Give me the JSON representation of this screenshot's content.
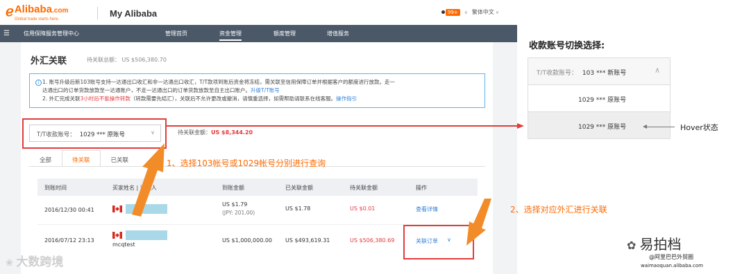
{
  "header": {
    "logo": "Alibaba",
    "logo_suffix": ".com",
    "logo_tagline": "Global trade starts here.",
    "my_alibaba": "My Alibaba",
    "badge": "99+",
    "language": "繁体中文"
  },
  "navbar": {
    "section_title": "信用保障服务管理中心",
    "tabs": [
      {
        "label": "管理首页",
        "active": false
      },
      {
        "label": "资金管理",
        "active": true
      },
      {
        "label": "额度管理",
        "active": false
      },
      {
        "label": "增值服务",
        "active": false
      }
    ]
  },
  "page": {
    "title": "外汇关联",
    "pending_total": "待关联总额： US $506,380.70",
    "notice_line1": "1. 账号升级后新103账号支持一达通出口收汇和非一达通出口收汇，T/T款项到账后资金将冻结，需关联至信用保障订单并根据客户的额度进行放款。走一",
    "notice_line2a": "达通出口的订单货款放款至一达通账户，不走一达通出口的订单货款放款至自主出口账户。",
    "notice_line2_link": "升级T/T账号",
    "notice_line3a": "2. 外汇完成关联",
    "notice_line3_red": "3小时后不能操作转款",
    "notice_line3b": "（转款需要先结汇），关联后不允许更改或撤消，请慎重选择，如需帮助请联系在线客服。",
    "notice_line3_link": "操作指引",
    "account_label": "T/T收款账号：",
    "account_value": "1029 *** 原账号",
    "pending_label": "待关联金额：",
    "pending_value": "US $8,344.20",
    "tabs": [
      {
        "label": "全部",
        "active": false
      },
      {
        "label": "待关联",
        "active": true
      },
      {
        "label": "已关联",
        "active": false
      }
    ],
    "columns": [
      "到账时间",
      "买家姓名 | 汇款人",
      "到账金额",
      "已关联金额",
      "待关联金额",
      "操作"
    ],
    "rows": [
      {
        "time": "2016/12/30 00:41",
        "payer": "",
        "received": "US $1.79",
        "received_note": "(JPY: 201.00)",
        "linked": "US $1.78",
        "pending": "US $0.01",
        "action": "查看详情"
      },
      {
        "time": "2016/07/12 23:13",
        "payer": "mcqtest",
        "received": "US $1,000,000.00",
        "linked": "US $493,619.31",
        "pending": "US $506,380.69",
        "action": "关联订单"
      }
    ]
  },
  "right_panel": {
    "title": "收款账号切换选择:",
    "dropdown_label": "T/T收款账号：",
    "dropdown_selected": "103 *** 新账号",
    "options": [
      "1029 *** 原账号",
      "1029 *** 原账号"
    ],
    "hover_label": "Hover状态"
  },
  "annotations": {
    "step1": "1、选择103帐号或1029帐号分别进行查询",
    "step2": "2、选择对应外汇进行关联"
  },
  "watermarks": {
    "left": "大数跨境",
    "right": "易拍档",
    "right_sub1": "@阿里巴巴外贸圈",
    "right_sub2": "waimaoquan.alibaba.com"
  },
  "colors": {
    "brand": "#ff6a00",
    "nav_bg": "#4a5868",
    "annotation_red": "#e23b3b",
    "link": "#2f7fd8"
  }
}
